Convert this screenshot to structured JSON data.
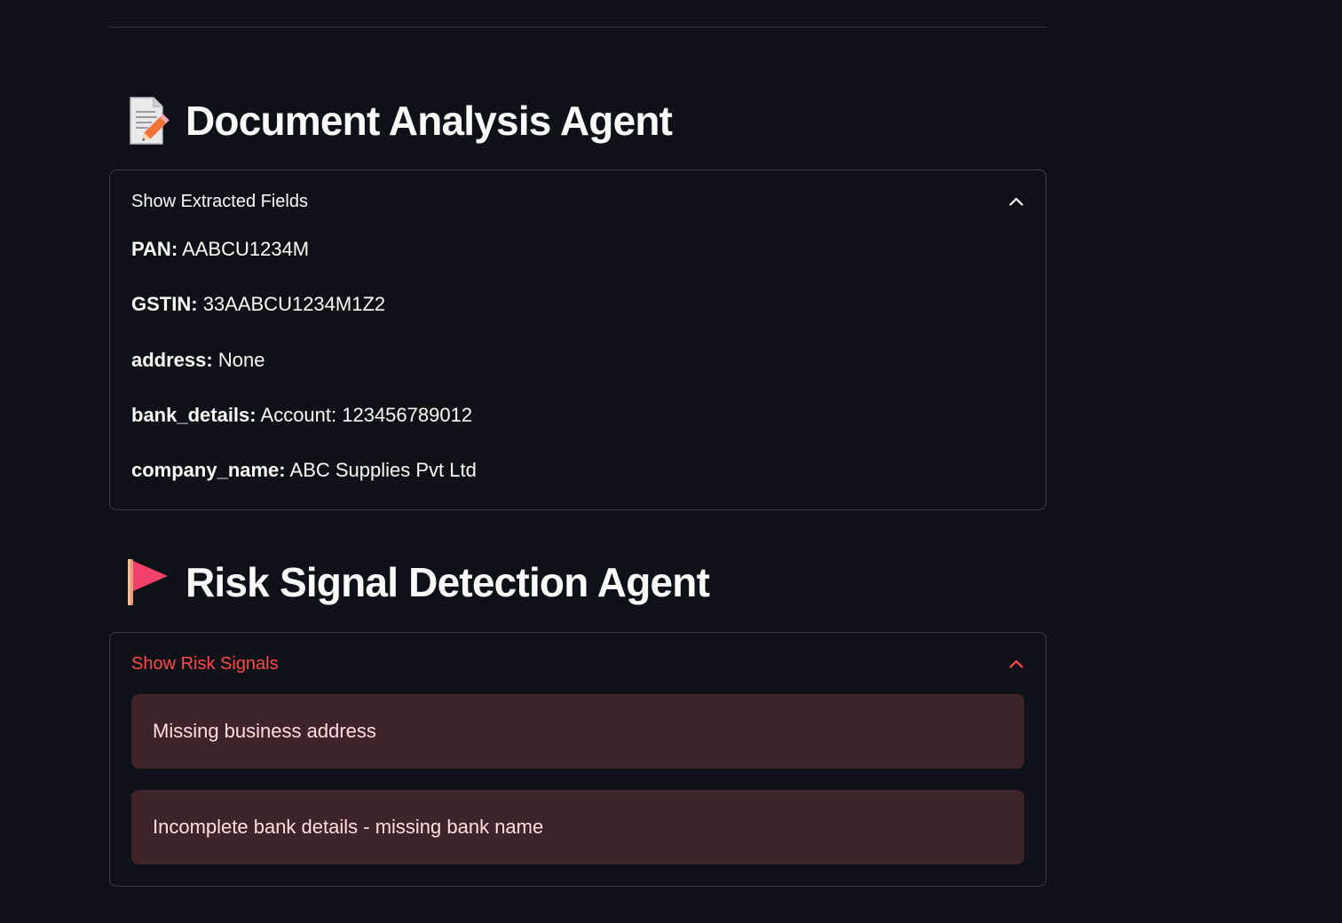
{
  "sections": {
    "document_analysis": {
      "icon": "memo-icon",
      "title": "Document Analysis Agent",
      "expander_label": "Show Extracted Fields",
      "expanded": true,
      "fields": [
        {
          "key": "PAN:",
          "value": "AABCU1234M"
        },
        {
          "key": "GSTIN:",
          "value": "33AABCU1234M1Z2"
        },
        {
          "key": "address:",
          "value": "None"
        },
        {
          "key": "bank_details:",
          "value": "Account: 123456789012"
        },
        {
          "key": "company_name:",
          "value": "ABC Supplies Pvt Ltd"
        }
      ]
    },
    "risk_signal": {
      "icon": "red-flag-icon",
      "title": "Risk Signal Detection Agent",
      "expander_label": "Show Risk Signals",
      "expanded": true,
      "signals": [
        "Missing business address",
        "Incomplete bank details - missing bank name"
      ]
    }
  },
  "colors": {
    "background": "#0e1117",
    "text": "#fafafa",
    "accent_red": "#ff4b4b",
    "error_box": "#3e2329",
    "error_text": "#ffdede",
    "border": "#3a3d47"
  }
}
